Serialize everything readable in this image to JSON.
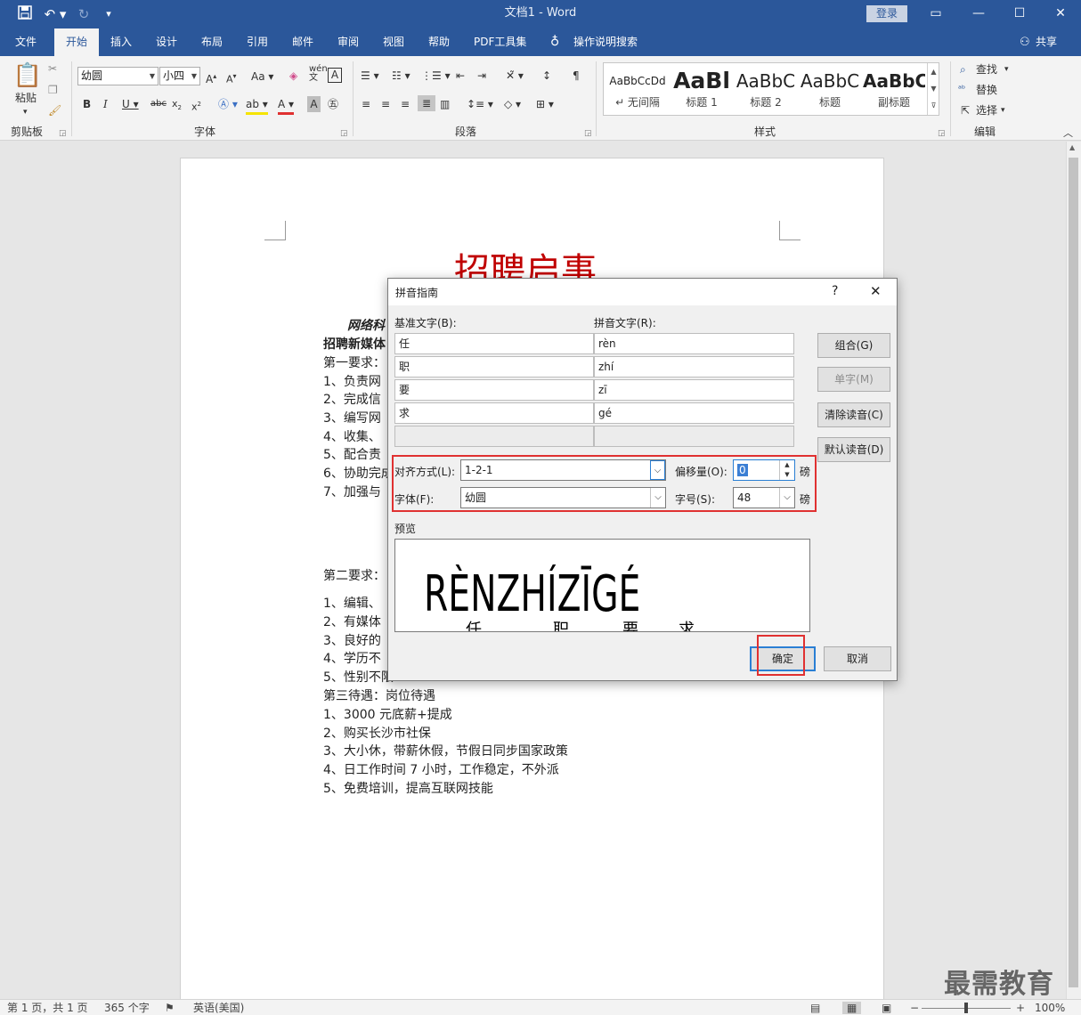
{
  "window": {
    "title": "文档1  -  Word",
    "login": "登录"
  },
  "menu": {
    "items": [
      "文件",
      "开始",
      "插入",
      "设计",
      "布局",
      "引用",
      "邮件",
      "审阅",
      "视图",
      "帮助",
      "PDF工具集"
    ],
    "tell_me": "操作说明搜索",
    "share": "共享"
  },
  "ribbon": {
    "clipboard": {
      "paste": "粘贴",
      "label": "剪贴板"
    },
    "font": {
      "name": "幼圆",
      "size": "小四",
      "label": "字体"
    },
    "paragraph": {
      "label": "段落"
    },
    "styles": {
      "label": "样式",
      "items": [
        {
          "preview": "AaBbCcDd",
          "name": "↵ 无间隔"
        },
        {
          "preview": "AaBl",
          "name": "标题 1"
        },
        {
          "preview": "AaBbC",
          "name": "标题 2"
        },
        {
          "preview": "AaBbC",
          "name": "标题"
        },
        {
          "preview": "AaBbC",
          "name": "副标题"
        }
      ]
    },
    "editing": {
      "find": "查找",
      "replace": "替换",
      "select": "选择",
      "label": "编辑"
    }
  },
  "document": {
    "title": "招聘启事",
    "lines1": [
      "网络科",
      "招聘新媒体",
      "第一要求：",
      "1、负责网",
      "2、完成信",
      "3、编写网",
      "4、收集、",
      "5、配合责",
      "6、协助完成",
      "7、加强与"
    ],
    "section2": "第二要求：",
    "lines2": [
      "1、编辑、",
      "2、有媒体",
      "3、良好的",
      "4、学历不",
      "5、性别不限"
    ],
    "lines3": [
      "第三待遇：岗位待遇",
      "1、3000 元底薪+提成",
      "2、购买长沙市社保",
      "3、大小休，带薪休假，节假日同步国家政策",
      "4、日工作时间 7 小时，工作稳定，不外派",
      "5、免费培训，提高互联网技能"
    ]
  },
  "dialog": {
    "title": "拼音指南",
    "help": "?",
    "base_label": "基准文字(B):",
    "ruby_label": "拼音文字(R):",
    "rows": [
      {
        "base": "任",
        "ruby": "rèn"
      },
      {
        "base": "职",
        "ruby": "zhí"
      },
      {
        "base": "要",
        "ruby": "zī"
      },
      {
        "base": "求",
        "ruby": "gé"
      }
    ],
    "buttons": {
      "combine": "组合(G)",
      "single": "单字(M)",
      "clear": "清除读音(C)",
      "default": "默认读音(D)",
      "ok": "确定",
      "cancel": "取消"
    },
    "align_label": "对齐方式(L):",
    "align_value": "1-2-1",
    "offset_label": "偏移量(O):",
    "offset_value": "0",
    "font_label": "字体(F):",
    "font_value": "幼圆",
    "size_label": "字号(S):",
    "size_value": "48",
    "unit": "磅",
    "preview_label": "预览",
    "preview_text": "RÈNZHÍZĪGÉ",
    "preview_base": [
      "任",
      "职",
      "要",
      "求"
    ]
  },
  "status": {
    "page": "第 1 页，共 1 页",
    "words": "365 个字",
    "lang": "英语(美国)",
    "zoom": "100%"
  },
  "watermark": "最需教育",
  "colors": {
    "brand": "#2b579a",
    "highlight": "#e03131",
    "doc_title": "#c00000"
  }
}
